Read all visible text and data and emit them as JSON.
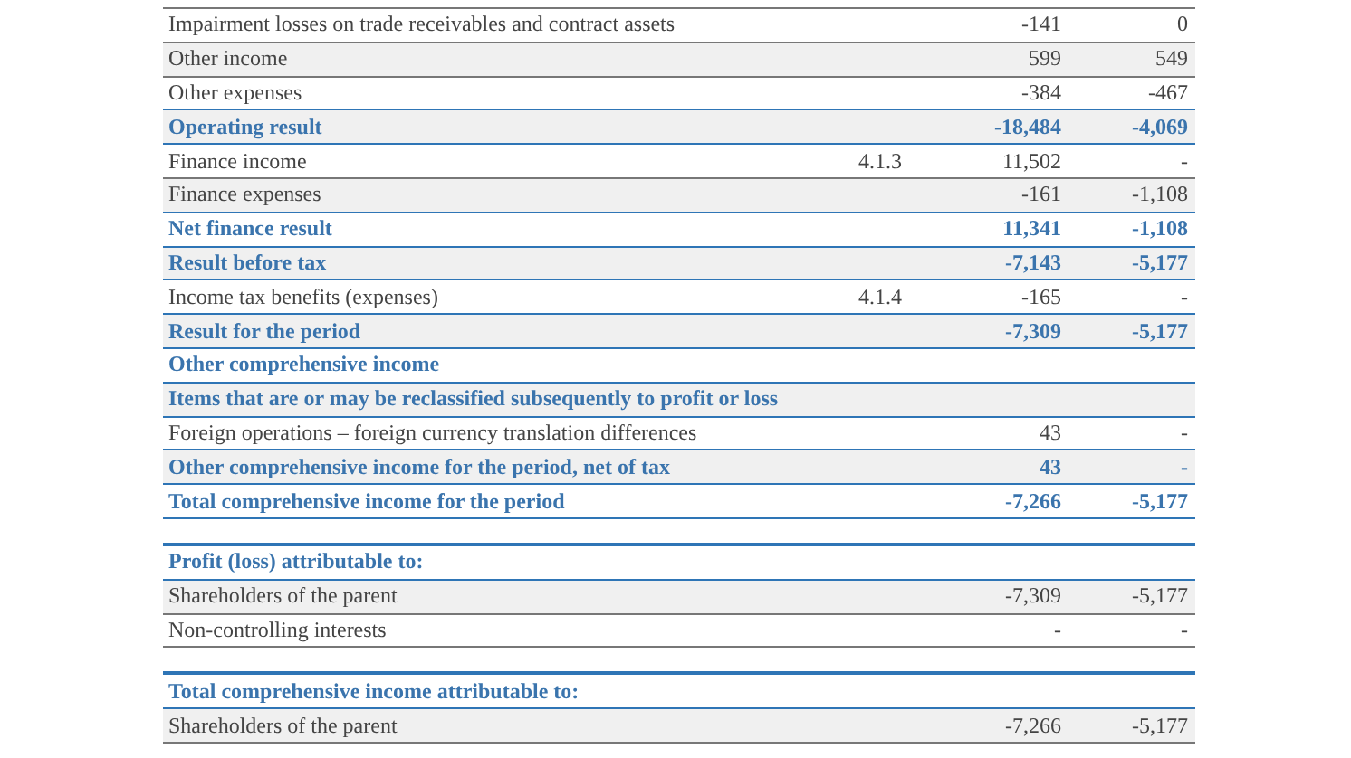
{
  "sections": [
    {
      "rows": [
        {
          "kind": "line",
          "shaded": false,
          "label": "Impairment losses on trade receivables and contract assets",
          "note": "",
          "value_1": "-141",
          "value_2": "0"
        },
        {
          "kind": "line",
          "shaded": true,
          "label": "Other income",
          "note": "",
          "value_1": "599",
          "value_2": "549"
        },
        {
          "kind": "line",
          "shaded": false,
          "label": "Other expenses",
          "note": "",
          "value_1": "-384",
          "value_2": "-467"
        },
        {
          "kind": "total",
          "shaded": true,
          "label": "Operating result",
          "note": "",
          "value_1": "-18,484",
          "value_2": "-4,069"
        },
        {
          "kind": "line",
          "shaded": false,
          "label": "Finance income",
          "note": "4.1.3",
          "value_1": "11,502",
          "value_2": "-"
        },
        {
          "kind": "line",
          "shaded": true,
          "label": "Finance expenses",
          "note": "",
          "value_1": "-161",
          "value_2": "-1,108"
        },
        {
          "kind": "total",
          "shaded": false,
          "label": "Net finance result",
          "note": "",
          "value_1": "11,341",
          "value_2": "-1,108"
        },
        {
          "kind": "total",
          "shaded": true,
          "label": "Result before tax",
          "note": "",
          "value_1": "-7,143",
          "value_2": "-5,177"
        },
        {
          "kind": "line",
          "shaded": false,
          "label": "Income tax benefits (expenses)",
          "note": "4.1.4",
          "value_1": "-165",
          "value_2": "-"
        },
        {
          "kind": "total",
          "shaded": true,
          "label": "Result for the period",
          "note": "",
          "value_1": "-7,309",
          "value_2": "-5,177"
        },
        {
          "kind": "total",
          "shaded": false,
          "label": "Other comprehensive income",
          "note": "",
          "value_1": "",
          "value_2": ""
        },
        {
          "kind": "total",
          "shaded": true,
          "label": "Items that are or may be reclassified subsequently to profit or loss",
          "note": "",
          "value_1": "",
          "value_2": ""
        },
        {
          "kind": "line",
          "shaded": false,
          "label": "Foreign operations – foreign currency translation differences",
          "note": "",
          "value_1": "43",
          "value_2": "-"
        },
        {
          "kind": "total",
          "shaded": true,
          "label": "Other comprehensive income for the period, net of tax",
          "note": "",
          "value_1": "43",
          "value_2": "-"
        },
        {
          "kind": "total",
          "shaded": false,
          "label": "Total comprehensive income for the period",
          "note": "",
          "value_1": "-7,266",
          "value_2": "-5,177"
        }
      ]
    },
    {
      "rows": [
        {
          "kind": "heading",
          "shaded": false,
          "label": "Profit (loss) attributable to:",
          "note": "",
          "value_1": "",
          "value_2": ""
        },
        {
          "kind": "line",
          "shaded": true,
          "label": "Shareholders of the parent",
          "note": "",
          "value_1": "-7,309",
          "value_2": "-5,177"
        },
        {
          "kind": "line",
          "shaded": false,
          "label": "Non-controlling interests",
          "note": "",
          "value_1": "-",
          "value_2": "-"
        }
      ]
    },
    {
      "rows": [
        {
          "kind": "heading",
          "shaded": false,
          "label": "Total comprehensive income attributable to:",
          "note": "",
          "value_1": "",
          "value_2": ""
        },
        {
          "kind": "line",
          "shaded": true,
          "label": "Shareholders of the parent",
          "note": "",
          "value_1": "-7,266",
          "value_2": "-5,177"
        }
      ]
    }
  ]
}
